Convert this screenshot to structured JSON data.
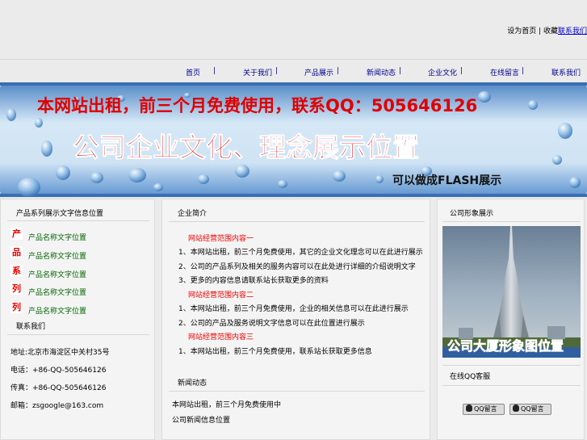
{
  "header": {
    "top_text": "设为首页 | 收藏",
    "top_link": "联系我们"
  },
  "nav": {
    "items": [
      {
        "label": "首页"
      },
      {
        "label": "关于我们"
      },
      {
        "label": "产品展示"
      },
      {
        "label": "新闻动态"
      },
      {
        "label": "企业文化"
      },
      {
        "label": "在线留言"
      },
      {
        "label": "联系我们"
      }
    ],
    "separator": "|"
  },
  "banner": {
    "line1": "本网站出租，前三个月免费使用，联系QQ：505646126",
    "line2": "公司企业文化、理念展示位置",
    "line3": "可以做成FLASH展示"
  },
  "left": {
    "title": "产品系列展示文字信息位置",
    "product_chars": [
      "产",
      "品",
      "系",
      "列",
      "列"
    ],
    "product_links": [
      "产品名称文字位置",
      "产品名称文字位置",
      "产品名称文字位置",
      "产品名称文字位置",
      "产品名称文字位置"
    ],
    "contact_title": "联系我们",
    "contact_lines": [
      "地址:北京市海淀区中关村35号",
      "电话：+86-QQ-505646126",
      "传真：+86-QQ-505646126",
      "邮箱：zsgoogle@163.com"
    ]
  },
  "center": {
    "title": "企业简介",
    "groups": [
      {
        "heading": "网站经营范围内容一",
        "lines": [
          "1、本网站出租，前三个月免费使用，其它的企业文化理念可以在此进行展示",
          "2、公司的产品系列及相关的服务内容可以在此处进行详细的介绍说明文字",
          "3、更多的内容信息请联系站长获取更多的资料"
        ]
      },
      {
        "heading": "网站经营范围内容二",
        "lines": [
          "1、本网站出租，前三个月免费使用，企业的相关信息可以在此进行展示",
          "2、公司的产品及服务说明文字信息可以在此位置进行展示"
        ]
      },
      {
        "heading": "网站经营范围内容三",
        "lines": [
          "1、本网站出租，前三个月免费使用，联系站长获取更多信息"
        ]
      }
    ],
    "news_title": "新闻动态",
    "news_lines": [
      "本网站出租，前三个月免费使用中",
      "公司新闻信息位置"
    ]
  },
  "right": {
    "title": "公司形象展示",
    "image_caption": "公司大厦形象图位置",
    "qq_title": "在线QQ客服",
    "qq_buttons": [
      "QQ留言",
      "QQ留言"
    ]
  },
  "colors": {
    "background": "#ebebeb",
    "nav_text": "#00008b",
    "accent_red": "#e00000",
    "link_green": "#006400",
    "banner_blue": "#5a9bd4"
  }
}
